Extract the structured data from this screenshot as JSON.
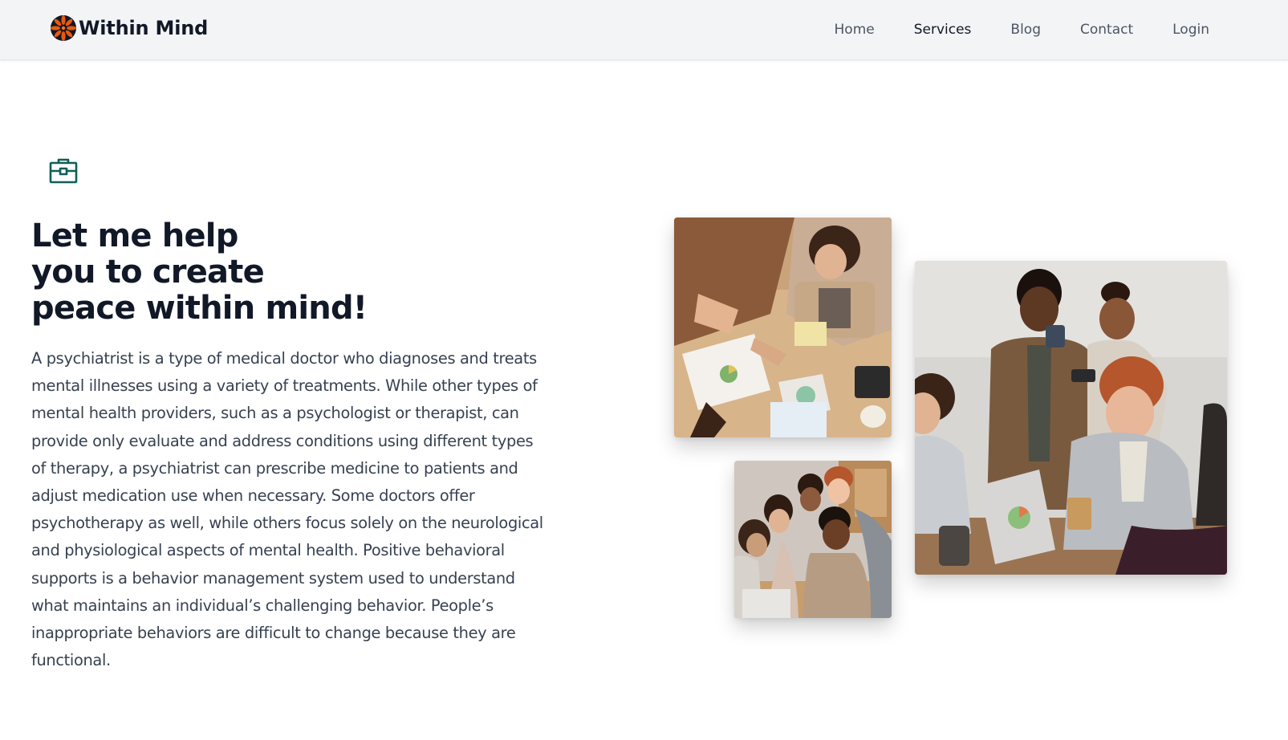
{
  "brand": {
    "name": "Within Mind",
    "logo_icon": "flower-logo-icon",
    "logo_colors": [
      "#ea580c",
      "#111827"
    ]
  },
  "nav": {
    "items": [
      {
        "label": "Home",
        "active": false
      },
      {
        "label": "Services",
        "active": true
      },
      {
        "label": "Blog",
        "active": false
      },
      {
        "label": "Contact",
        "active": false
      },
      {
        "label": "Login",
        "active": false
      }
    ]
  },
  "hero": {
    "icon": "briefcase-icon",
    "icon_color": "#115e59",
    "headline_lines": [
      "Let me help",
      "you to create",
      "peace within mind!"
    ],
    "body": "A psychiatrist is a type of medical doctor who diagnoses and treats mental illnesses using a variety of treatments. While other types of mental health providers, such as a psychologist or therapist, can provide only evaluate and address conditions using different types of therapy, a psychiatrist can prescribe medicine to patients and adjust medication use when necessary. Some doctors offer psychotherapy as well, while others focus solely on the neurological and physiological aspects of mental health. Positive behavioral supports is a behavior management system used to understand what maintains an individual’s challenging behavior. People’s inappropriate behaviors are difficult to change because they are functional."
  },
  "gallery": {
    "images": [
      {
        "subject": "team-meeting-overhead-photo"
      },
      {
        "subject": "team-laptop-group-photo"
      },
      {
        "subject": "office-coffee-discussion-photo"
      }
    ]
  },
  "colors": {
    "navbar_bg": "#f3f4f6",
    "heading": "#111827",
    "body_text": "#374151",
    "nav_text": "#4b5563"
  }
}
